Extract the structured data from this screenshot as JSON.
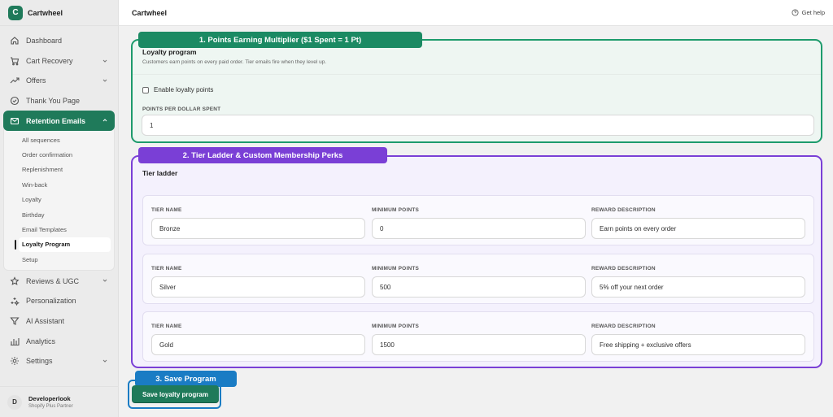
{
  "brand": {
    "logo_letter": "C",
    "name": "Cartwheel"
  },
  "nav": {
    "items": [
      {
        "label": "Dashboard",
        "icon": "home-icon"
      },
      {
        "label": "Cart Recovery",
        "icon": "cart-icon"
      },
      {
        "label": "Offers",
        "icon": "trend-icon"
      },
      {
        "label": "Thank You Page",
        "icon": "check-circle-icon"
      },
      {
        "label": "Retention Emails",
        "icon": "mail-icon"
      },
      {
        "label": "Reviews & UGC",
        "icon": "star-icon"
      },
      {
        "label": "Personalization",
        "icon": "sparkle-icon"
      },
      {
        "label": "AI Assistant",
        "icon": "funnel-icon"
      },
      {
        "label": "Analytics",
        "icon": "bar-chart-icon"
      },
      {
        "label": "Settings",
        "icon": "gear-icon"
      }
    ],
    "retention_sub": [
      "All sequences",
      "Order confirmation",
      "Replenishment",
      "Win-back",
      "Loyalty",
      "Birthday",
      "Email Templates",
      "Loyalty Program",
      "Setup"
    ]
  },
  "user": {
    "initial": "D",
    "name": "Developerlook",
    "role": "Shopify Plus Partner"
  },
  "topbar": {
    "title": "Cartwheel",
    "help": "Get help"
  },
  "callouts": {
    "one": "1. Points Earning Multiplier ($1 Spent = 1 Pt)",
    "two": "2. Tier Ladder & Custom Membership Perks",
    "three": "3. Save Program"
  },
  "loyalty": {
    "title": "Loyalty program",
    "subtitle": "Customers earn points on every paid order. Tier emails fire when they level up.",
    "enable_label": "Enable loyalty points",
    "points_label": "POINTS PER DOLLAR SPENT",
    "points_value": "1"
  },
  "tiers": {
    "title": "Tier ladder",
    "col_name": "TIER NAME",
    "col_min": "MINIMUM POINTS",
    "col_reward": "REWARD DESCRIPTION",
    "rows": [
      {
        "name": "Bronze",
        "min": "0",
        "reward": "Earn points on every order"
      },
      {
        "name": "Silver",
        "min": "500",
        "reward": "5% off your next order"
      },
      {
        "name": "Gold",
        "min": "1500",
        "reward": "Free shipping + exclusive offers"
      }
    ]
  },
  "save_label": "Save loyalty program"
}
